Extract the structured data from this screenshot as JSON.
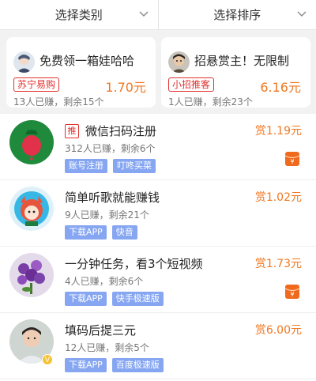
{
  "filters": {
    "category_label": "选择类别",
    "sort_label": "选择排序"
  },
  "featured": [
    {
      "title": "免费领一箱娃哈哈",
      "tag": "苏宁易购",
      "price": "1.70元",
      "stats": "13人已赚，剩余15个"
    },
    {
      "title": "招悬赏主！无限制",
      "tag": "小招推客",
      "price": "6.16元",
      "stats": "1人已赚，剩余23个"
    }
  ],
  "tasks": [
    {
      "pinned": "推",
      "title": "微信扫码注册",
      "stats": "312人已赚，剩余6个",
      "chips": [
        "账号注册",
        "叮咚买菜"
      ],
      "reward": "赏1.19元",
      "has_envelope": true
    },
    {
      "title": "简单听歌就能赚钱",
      "stats": "9人已赚，剩余21个",
      "chips": [
        "下载APP",
        "快音"
      ],
      "reward": "赏1.02元",
      "has_envelope": false
    },
    {
      "title": "一分钟任务，看3个短视频",
      "stats": "4人已赚，剩余6个",
      "chips": [
        "下载APP",
        "快手极速版"
      ],
      "reward": "赏1.73元",
      "has_envelope": true
    },
    {
      "title": "填码后提三元",
      "stats": "12人已赚，剩余5个",
      "chips": [
        "下载APP",
        "百度极速版"
      ],
      "reward": "赏6.00元",
      "has_envelope": false,
      "verified_badge": "V"
    }
  ],
  "icons": {
    "chevron": "chevron-down-icon",
    "envelope": "red-envelope-icon",
    "envelope_glyph": "¥"
  },
  "colors": {
    "accent_orange": "#f07822",
    "tag_red": "#e0312e",
    "chip_blue": "#86a6f2"
  }
}
